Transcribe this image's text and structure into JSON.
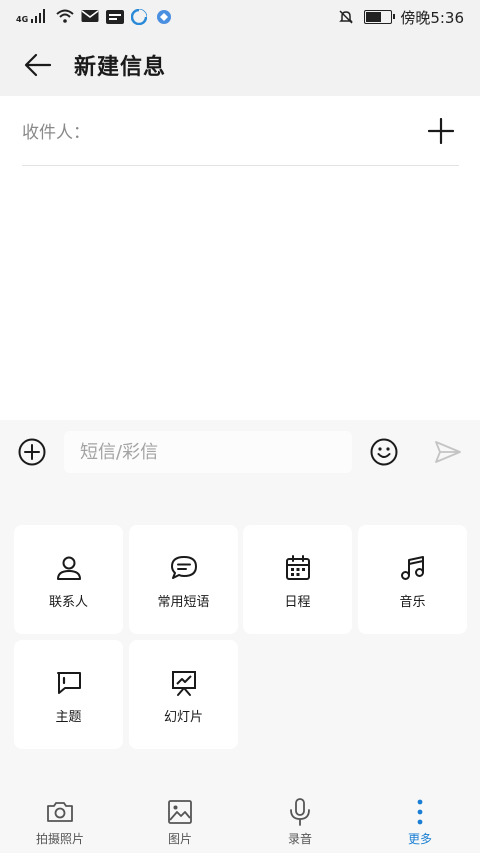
{
  "status_bar": {
    "network": "4G",
    "time": "傍晚5:36",
    "battery_level": 0.55,
    "icons": [
      "signal-icon",
      "wifi-icon",
      "mail-icon",
      "app-notification-icon",
      "browser-icon",
      "app-icon",
      "mute-icon",
      "battery-icon"
    ]
  },
  "header": {
    "title": "新建信息",
    "back_icon": "arrow-left-icon"
  },
  "recipient": {
    "label": "收件人：",
    "add_icon": "plus-icon"
  },
  "input_bar": {
    "placeholder": "短信/彩信",
    "value": "",
    "icons": [
      "add-circle-icon",
      "emoji-icon",
      "send-icon"
    ]
  },
  "panel": {
    "items": [
      {
        "label": "联系人",
        "icon": "contact-icon"
      },
      {
        "label": "常用短语",
        "icon": "phrase-bubble-icon"
      },
      {
        "label": "日程",
        "icon": "calendar-icon"
      },
      {
        "label": "音乐",
        "icon": "music-note-icon"
      },
      {
        "label": "主题",
        "icon": "subject-icon"
      },
      {
        "label": "幻灯片",
        "icon": "slideshow-icon"
      }
    ]
  },
  "tabs": [
    {
      "label": "拍摄照片",
      "icon": "camera-icon",
      "active": false
    },
    {
      "label": "图片",
      "icon": "image-icon",
      "active": false
    },
    {
      "label": "录音",
      "icon": "microphone-icon",
      "active": false
    },
    {
      "label": "更多",
      "icon": "more-vertical-icon",
      "active": true
    }
  ],
  "colors": {
    "accent": "#1a7fd4",
    "background": "#f7f7f7",
    "header_background": "#f2f2f2",
    "text": "#1a1a1a",
    "muted": "#8a8a8a"
  }
}
